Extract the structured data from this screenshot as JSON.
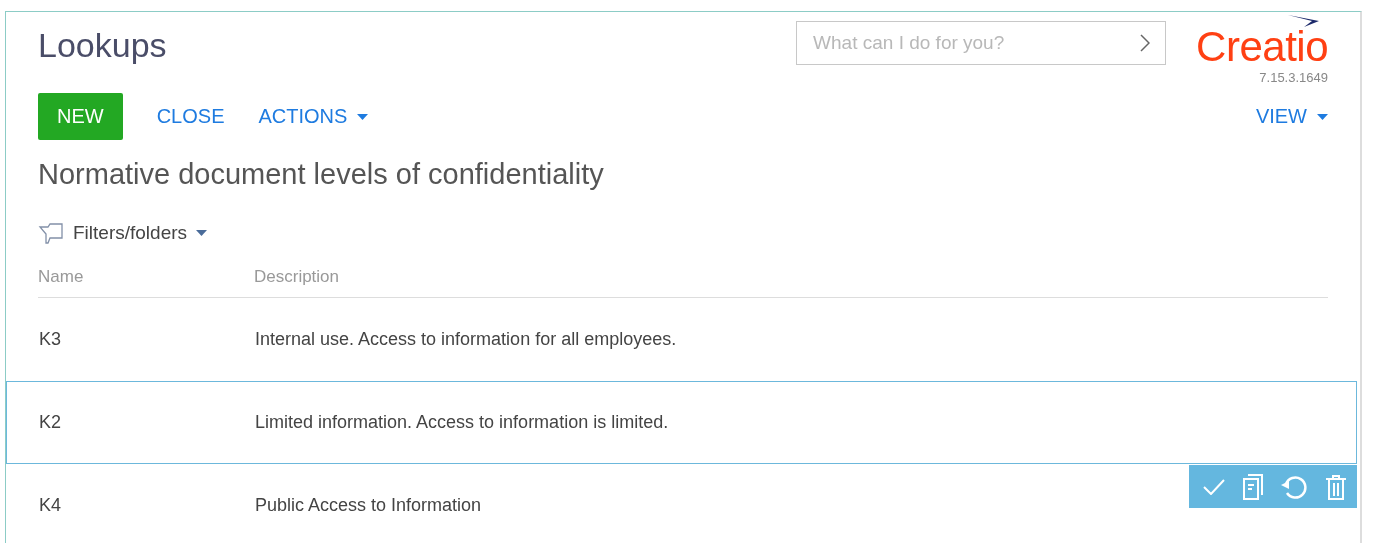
{
  "header": {
    "title": "Lookups",
    "search": {
      "placeholder": "What can I do for you?"
    },
    "logo": "Creatio",
    "version": "7.15.3.1649"
  },
  "toolbar": [
    {
      "label": "NEW",
      "kind": "primary"
    },
    {
      "label": "CLOSE",
      "kind": "link"
    },
    {
      "label": "ACTIONS",
      "kind": "menu"
    }
  ],
  "view_button": {
    "label": "VIEW",
    "kind": "menu"
  },
  "section_title": "Normative document levels of confidentiality",
  "filter": {
    "label": "Filters/folders"
  },
  "table": {
    "columns": [
      "Name",
      "Description"
    ],
    "rows": [
      {
        "name": "K3",
        "description": "Internal use. Access to information for all employees.",
        "selected": false
      },
      {
        "name": "K2",
        "description": "Limited information. Access to information is limited.",
        "selected": true
      },
      {
        "name": "K4",
        "description": "Public Access to Information",
        "selected": false
      }
    ]
  }
}
